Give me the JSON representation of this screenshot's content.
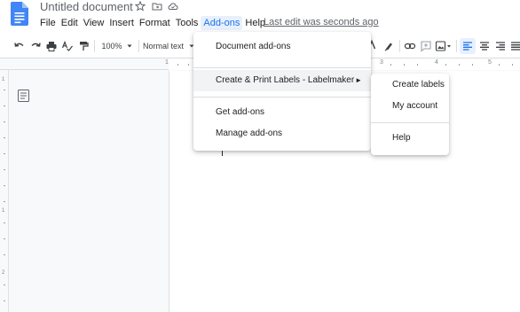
{
  "document": {
    "title": "Untitled document",
    "last_edit": "Last edit was seconds ago"
  },
  "menubar": {
    "items": [
      "File",
      "Edit",
      "View",
      "Insert",
      "Format",
      "Tools",
      "Add-ons",
      "Help"
    ],
    "active": "Add-ons"
  },
  "toolbar": {
    "zoom": "100%",
    "style": "Normal text"
  },
  "ruler": {
    "marks": [
      "1",
      "1",
      "2",
      "3",
      "4",
      "5"
    ]
  },
  "vruler": {
    "marks": [
      "1",
      "1",
      "2"
    ]
  },
  "addons_menu": {
    "items": [
      "Document add-ons",
      "Create & Print Labels - Labelmaker",
      "Get add-ons",
      "Manage add-ons"
    ],
    "submenu_arrow": "►"
  },
  "labelmaker_submenu": {
    "items": [
      "Create labels",
      "My account",
      "Help"
    ]
  },
  "colors": {
    "accent": "#1a73e8",
    "active_bg": "#e8f0fe",
    "docs_blue": "#4285f4"
  }
}
